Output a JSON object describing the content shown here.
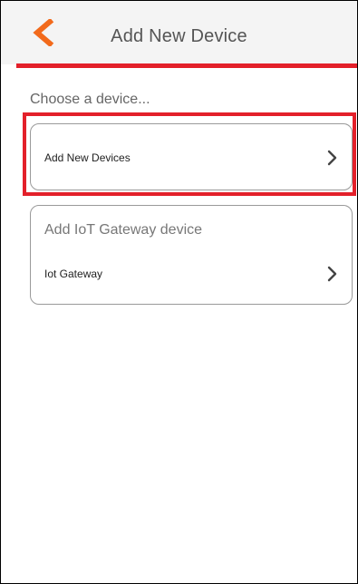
{
  "header": {
    "title": "Add New Device",
    "back_icon": "chevron-left-icon",
    "accent_color": "#f26a1b",
    "underline_color": "#e3202a"
  },
  "main": {
    "section_label": "Choose a device...",
    "cards": [
      {
        "heading": "",
        "item_label": "Add New Devices",
        "icon": "chevron-right-icon"
      },
      {
        "heading": "Add IoT Gateway device",
        "item_label": "Iot Gateway",
        "icon": "chevron-right-icon"
      }
    ]
  }
}
